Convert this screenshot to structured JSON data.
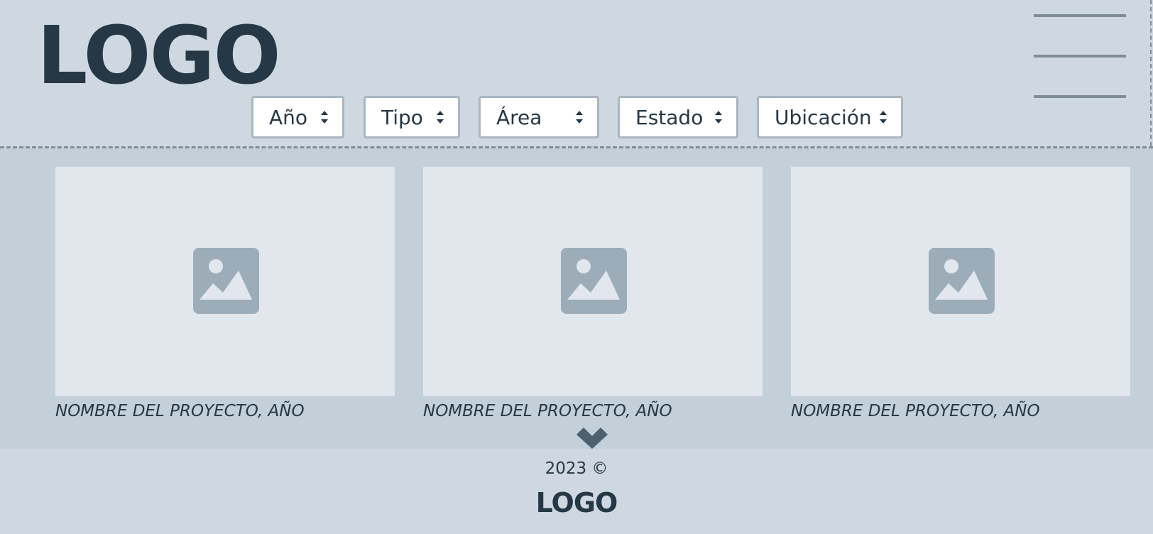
{
  "header": {
    "logo": "LOGO",
    "menu_icon": "hamburger-menu-icon"
  },
  "filters": [
    {
      "label": "Año",
      "icon": "sort-arrows-icon"
    },
    {
      "label": "Tipo",
      "icon": "sort-arrows-icon"
    },
    {
      "label": "Área",
      "icon": "sort-arrows-icon"
    },
    {
      "label": "Estado",
      "icon": "sort-arrows-icon"
    },
    {
      "label": "Ubicación",
      "icon": "sort-arrows-icon"
    }
  ],
  "projects": [
    {
      "caption": "NOMBRE DEL PROYECTO, AÑO",
      "image_icon": "image-placeholder-icon"
    },
    {
      "caption": "NOMBRE DEL PROYECTO, AÑO",
      "image_icon": "image-placeholder-icon"
    },
    {
      "caption": "NOMBRE DEL PROYECTO, AÑO",
      "image_icon": "image-placeholder-icon"
    }
  ],
  "load_more_icon": "chevron-down-icon",
  "footer": {
    "copyright": "2023 ©",
    "logo": "LOGO"
  },
  "colors": {
    "background": "#cfd8e1",
    "content_background": "#c3cfd9",
    "card_placeholder": "#e1e7ed",
    "placeholder_icon": "#9dacb9",
    "text": "#263745",
    "divider": "#7f8d99"
  }
}
